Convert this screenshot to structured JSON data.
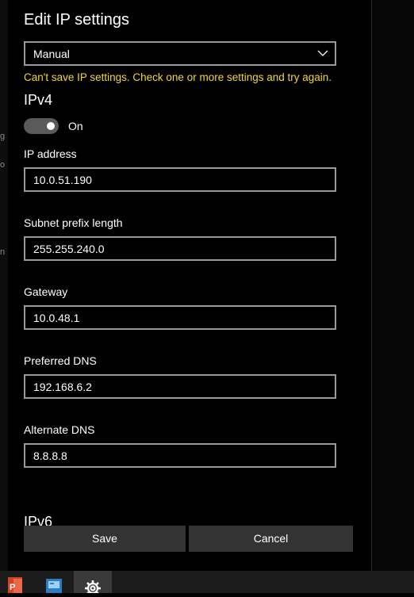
{
  "background": {
    "left_fragments": [
      "g",
      "o",
      "n"
    ]
  },
  "dialog": {
    "title": "Edit IP settings",
    "mode_select": {
      "value": "Manual",
      "icon": "chevron-down-icon"
    },
    "error_message": "Can't save IP settings. Check one or more settings and try again.",
    "ipv4": {
      "heading": "IPv4",
      "toggle": {
        "state": "On",
        "on": true
      },
      "fields": [
        {
          "label": "IP address",
          "value": "10.0.51.190"
        },
        {
          "label": "Subnet prefix length",
          "value": "255.255.240.0"
        },
        {
          "label": "Gateway",
          "value": "10.0.48.1"
        },
        {
          "label": "Preferred DNS",
          "value": "192.168.6.2"
        },
        {
          "label": "Alternate DNS",
          "value": "8.8.8.8"
        }
      ]
    },
    "ipv6": {
      "heading": "IPv6"
    },
    "buttons": {
      "save": "Save",
      "cancel": "Cancel"
    }
  },
  "taskbar": {
    "icons": [
      "powerpoint-icon",
      "network-settings-icon",
      "settings-gear-icon"
    ]
  },
  "colors": {
    "error": "#f2d63a",
    "button": "#333333",
    "field_border": "#9a9a9a",
    "toggle_track": "#5a5a5a"
  }
}
